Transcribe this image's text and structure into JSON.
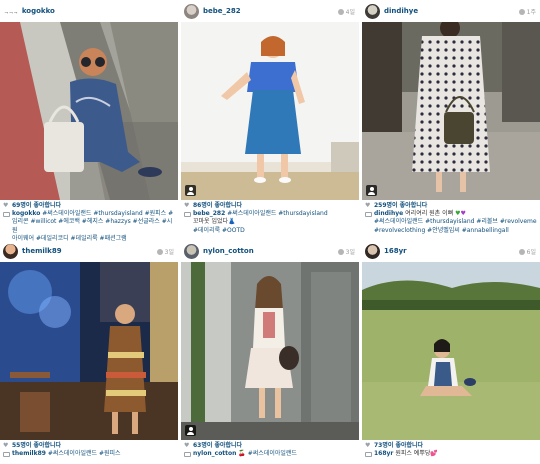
{
  "posts": [
    {
      "user": "kogokko",
      "user_prefix": "ᆨᆨᆨ",
      "time": "",
      "likes": "69명이 좋아합니다",
      "caption_user": "kogokko",
      "caption_lines": [
        "#써스데이아일랜드 #thursdayisland #원피스 #",
        "임리콘 #willicot #에코백 #헤지스 #hazzys #선글라스 #시원",
        "아이웨어 #데일리코디 #데일리룩 #패션그램"
      ],
      "has_user_badge": false
    },
    {
      "user": "bebe_282",
      "time": "4일",
      "likes": "86명이 좋아합니다",
      "caption_user": "bebe_282",
      "caption_lines": [
        "#써스데이아일랜드 #thursdayisland",
        "꼬마옷 입었다👗",
        "#데이리룩 #OOTD"
      ],
      "has_user_badge": true
    },
    {
      "user": "dindihye",
      "time": "1주",
      "likes": "259명이 좋아합니다",
      "caption_user": "dindihye",
      "caption_lines": [
        "여리여리 원촌 이뻐",
        "#써스데이아일랜드 #thursdayisland #리볼브 #revolveme",
        "#revolveclothing #안녕벨임씨 #annabellingall"
      ],
      "has_user_badge": true
    },
    {
      "user": "themilk89",
      "time": "3일",
      "likes": "55명이 좋아합니다",
      "caption_user": "themilk89",
      "caption_lines": [
        "#써스데이아일랜드 #원피스"
      ],
      "has_user_badge": false
    },
    {
      "user": "nylon_cotton",
      "time": "3일",
      "likes": "63명이 좋아합니다",
      "caption_user": "nylon_cotton",
      "caption_lines": [
        "🍒 #써스데이아일랜드"
      ],
      "has_user_badge": true
    },
    {
      "user": "168yr",
      "time": "6일",
      "likes": "73명이 좋아합니다",
      "caption_user": "168yr",
      "caption_lines": [
        "원피스 예뿌당💕"
      ],
      "has_user_badge": false
    }
  ],
  "colors": {
    "link": "#12507d",
    "meta_gray": "#9a9a9a",
    "icon_gray": "#9aa2aa"
  },
  "icons": {
    "heart": "heart-icon",
    "comment": "speech-bubble-icon",
    "time": "clock-icon",
    "tag": "tagged-user-icon"
  }
}
